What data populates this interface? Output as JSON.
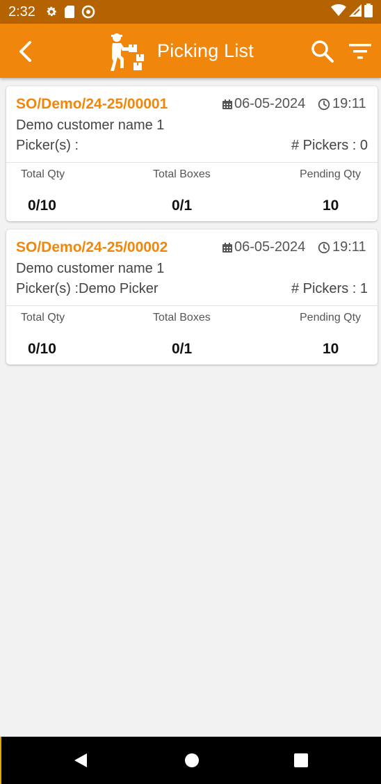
{
  "status_bar": {
    "time": "2:32",
    "icons": [
      "gear-icon",
      "sd-card-icon",
      "data-saver-icon",
      "wifi-icon",
      "signal-icon",
      "battery-icon"
    ]
  },
  "app_bar": {
    "title": "Picking List",
    "icons": [
      "back-arrow-icon",
      "picker-logo-icon",
      "search-icon",
      "filter-icon"
    ],
    "color": "#f0870c"
  },
  "labels": {
    "total_qty": "Total Qty",
    "total_boxes": "Total Boxes",
    "pending_qty": "Pending Qty"
  },
  "orders": [
    {
      "number": "SO/Demo/24-25/00001",
      "date": "06-05-2024",
      "time": "19:11",
      "customer": "Demo customer name 1",
      "pickers": "Picker(s) :",
      "picker_count": "# Pickers : 0",
      "total_qty": "0/10",
      "total_boxes": "0/1",
      "pending_qty": "10"
    },
    {
      "number": "SO/Demo/24-25/00002",
      "date": "06-05-2024",
      "time": "19:11",
      "customer": "Demo customer name 1",
      "pickers": "Picker(s) :Demo Picker",
      "picker_count": "# Pickers : 1",
      "total_qty": "0/10",
      "total_boxes": "0/1",
      "pending_qty": "10"
    }
  ],
  "nav_bar": {
    "icons": [
      "back-triangle-icon",
      "home-circle-icon",
      "recents-square-icon"
    ]
  }
}
